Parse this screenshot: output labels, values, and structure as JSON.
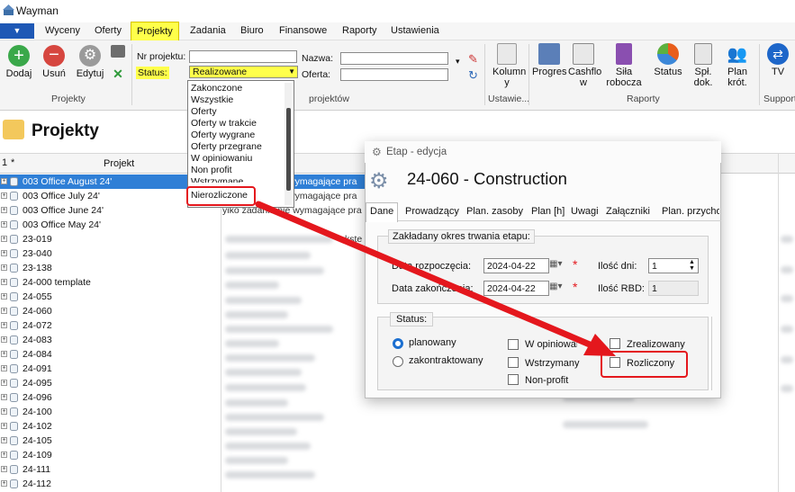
{
  "window": {
    "title": "Wayman"
  },
  "menu": {
    "app_button": "▼",
    "tabs": [
      "Wyceny",
      "Oferty",
      "Projekty",
      "Zadania",
      "Biuro",
      "Finansowe",
      "Raporty",
      "Ustawienia"
    ],
    "active_tab": "Projekty"
  },
  "ribbon": {
    "actions": {
      "add": "Dodaj",
      "remove": "Usuń",
      "edit": "Edytuj"
    },
    "group_projekty": "Projekty",
    "filters": {
      "nr_label": "Nr projektu:",
      "status_label": "Status:",
      "status_value": "Realizowane",
      "nazwa_label": "Nazwa:",
      "oferta_label": "Oferta:",
      "group_partial": "projektów"
    },
    "ustawienia": {
      "kolumny": "Kolumn y",
      "group": "Ustawie..."
    },
    "raporty": {
      "progres": "Progres",
      "cashflow": "Cashflo w",
      "sila": "Siła robocza",
      "status": "Status",
      "spl_dok": "Spł. dok.",
      "plan_krot": "Plan krót.",
      "group": "Raporty"
    },
    "support": {
      "tv": "TV",
      "group": "Support"
    }
  },
  "status_dropdown": {
    "options": [
      "Zakonczone",
      "Wszystkie",
      "Oferty",
      "Oferty w trakcie",
      "Oferty wygrane",
      "Oferty przegrane",
      "W opiniowaniu",
      "Non profit",
      "Wstrzymane",
      "Nierozliczone"
    ]
  },
  "projects": {
    "title": "Projekty",
    "col_num": "1",
    "col_star": "*",
    "col_project": "Projekt",
    "rows": [
      "003 Office August 24'",
      "003 Office July 24'",
      "003 Office June 24'",
      "003 Office May 24'",
      "23-019",
      "23-040",
      "23-138",
      "24-000 template",
      "24-055",
      "24-060",
      "24-072",
      "24-083",
      "24-084",
      "24-091",
      "24-095",
      "24-096",
      "24-100",
      "24-102",
      "24-105",
      "24-109",
      "24-111",
      "24-112"
    ],
    "ghost_text": "wymagające pra",
    "ghost_text2": "yiko zadania nie wymagające pra",
    "ghost_text3": "kste"
  },
  "dialog": {
    "title": "Etap - edycja",
    "heading": "24-060 - Construction",
    "tabs": [
      "Dane",
      "Prowadzący",
      "Plan. zasoby",
      "Plan [h]",
      "Uwagi",
      "Załączniki",
      "Plan. przycho"
    ],
    "period_group": "Zakładany okres trwania etapu:",
    "start_label": "Data rozpoczęcia:",
    "start_value": "2024-04-22",
    "end_label": "Data zakończenia:",
    "end_value": "2024-04-22",
    "days_label": "Ilość dni:",
    "days_value": "1",
    "rbd_label": "Ilość RBD:",
    "rbd_value": "1",
    "status_group": "Status:",
    "radio_planned": "planowany",
    "radio_contracted": "zakontraktowany",
    "check_opinion": "W opiniowaniu",
    "check_suspended": "Wstrzymany",
    "check_nonprofit": "Non-profit",
    "check_realized": "Zrealizowany",
    "check_settled": "Rozliczony"
  },
  "colors": {
    "accent": "#2f7fd6",
    "highlight": "#e4171d",
    "active_tab": "#ffff4a"
  }
}
